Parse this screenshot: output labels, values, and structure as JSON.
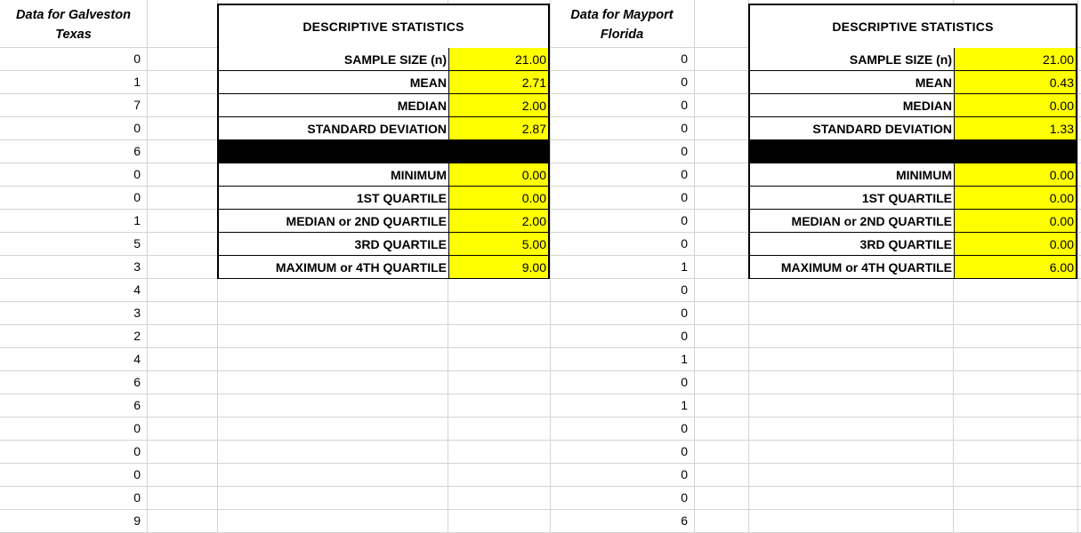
{
  "galveston": {
    "header_line1": "Data for Galveston",
    "header_line2": "Texas",
    "values": [
      "0",
      "1",
      "7",
      "0",
      "6",
      "0",
      "0",
      "1",
      "5",
      "3",
      "4",
      "3",
      "2",
      "4",
      "6",
      "6",
      "0",
      "0",
      "0",
      "0",
      "9"
    ]
  },
  "mayport": {
    "header_line1": "Data for Mayport",
    "header_line2": "Florida",
    "values": [
      "0",
      "0",
      "0",
      "0",
      "0",
      "0",
      "0",
      "0",
      "0",
      "1",
      "0",
      "0",
      "0",
      "1",
      "0",
      "1",
      "0",
      "0",
      "0",
      "0",
      "6"
    ]
  },
  "stats_left": {
    "title": "DESCRIPTIVE STATISTICS",
    "rows": [
      {
        "label": "SAMPLE SIZE (n)",
        "value": "21.00"
      },
      {
        "label": "MEAN",
        "value": "2.71"
      },
      {
        "label": "MEDIAN",
        "value": "2.00"
      },
      {
        "label": "STANDARD DEVIATION",
        "value": "2.87"
      },
      {
        "label": "MINIMUM",
        "value": "0.00"
      },
      {
        "label": "1ST QUARTILE",
        "value": "0.00"
      },
      {
        "label": "MEDIAN or 2ND QUARTILE",
        "value": "2.00"
      },
      {
        "label": "3RD QUARTILE",
        "value": "5.00"
      },
      {
        "label": "MAXIMUM or 4TH QUARTILE",
        "value": "9.00"
      }
    ]
  },
  "stats_right": {
    "title": "DESCRIPTIVE STATISTICS",
    "rows": [
      {
        "label": "SAMPLE SIZE (n)",
        "value": "21.00"
      },
      {
        "label": "MEAN",
        "value": "0.43"
      },
      {
        "label": "MEDIAN",
        "value": "0.00"
      },
      {
        "label": "STANDARD DEVIATION",
        "value": "1.33"
      },
      {
        "label": "MINIMUM",
        "value": "0.00"
      },
      {
        "label": "1ST QUARTILE",
        "value": "0.00"
      },
      {
        "label": "MEDIAN or 2ND QUARTILE",
        "value": "0.00"
      },
      {
        "label": "3RD QUARTILE",
        "value": "0.00"
      },
      {
        "label": "MAXIMUM or 4TH QUARTILE",
        "value": "6.00"
      }
    ]
  },
  "colors": {
    "highlight": "#ffff00",
    "gridline": "#d4d4d4",
    "border": "#000000"
  }
}
